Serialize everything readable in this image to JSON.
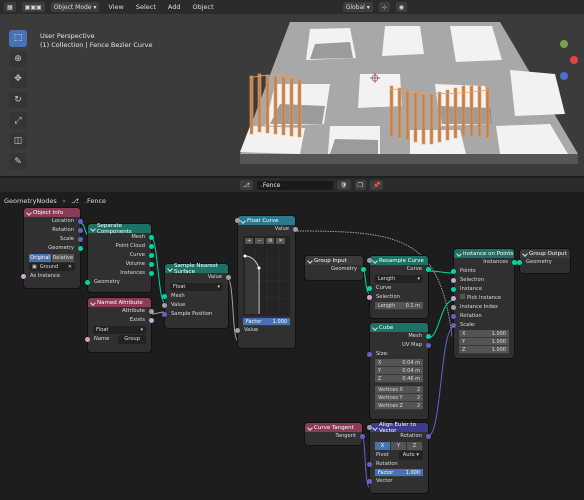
{
  "viewport": {
    "mode": "Object Mode",
    "menus": [
      "View",
      "Select",
      "Add",
      "Object"
    ],
    "transform_orientation": "Global",
    "info_line1": "User Perspective",
    "info_line2": "(1) Collection | Fence Bezier Curve"
  },
  "node_editor": {
    "tree_name": ".Fence",
    "breadcrumb_root": "GeometryNodes",
    "breadcrumb_tree": ".Fence"
  },
  "nodes": {
    "object_info": {
      "title": "Object Info",
      "outputs": [
        "Location",
        "Rotation",
        "Scale",
        "Geometry"
      ],
      "toggle": [
        "Original",
        "Relative"
      ],
      "object_value": "Ground",
      "as_instance": "As Instance"
    },
    "separate_components": {
      "title": "Separate Components",
      "outputs": [
        "Mesh",
        "Point Cloud",
        "Curve",
        "Volume",
        "Instances"
      ],
      "input": "Geometry"
    },
    "named_attribute": {
      "title": "Named Attribute",
      "outputs": [
        "Attribute",
        "Exists"
      ],
      "type": "Float",
      "name_label": "Name",
      "name_value": "Group"
    },
    "sample_nearest_surface": {
      "title": "Sample Nearest Surface",
      "output": "Value",
      "type": "Float",
      "inputs": [
        "Mesh",
        "Value",
        "Sample Position"
      ]
    },
    "float_curve": {
      "title": "Float Curve",
      "output": "Value",
      "factor_label": "Factor",
      "factor_value": "1.000",
      "input": "Value"
    },
    "group_input": {
      "title": "Group Input",
      "output": "Geometry"
    },
    "resample_curve": {
      "title": "Resample Curve",
      "output": "Curve",
      "mode": "Length",
      "inputs": [
        "Curve",
        "Selection"
      ],
      "length_label": "Length",
      "length_value": "0.1 m"
    },
    "cube": {
      "title": "Cube",
      "outputs": [
        "Mesh",
        "UV Map"
      ],
      "size_label": "Size:",
      "size": [
        [
          "X",
          "0.04 m"
        ],
        [
          "Y",
          "0.04 m"
        ],
        [
          "Z",
          "0.46 m"
        ]
      ],
      "vertices": [
        [
          "Vertices X",
          "2"
        ],
        [
          "Vertices Y",
          "2"
        ],
        [
          "Vertices Z",
          "2"
        ]
      ]
    },
    "instance_on_points": {
      "title": "Instance on Points",
      "output": "Instances",
      "inputs": [
        "Points",
        "Selection",
        "Instance",
        "Pick Instance",
        "Instance Index",
        "Rotation"
      ],
      "scale_label": "Scale:",
      "scale": [
        [
          "X",
          "1.000"
        ],
        [
          "Y",
          "1.000"
        ],
        [
          "Z",
          "1.000"
        ]
      ]
    },
    "group_output": {
      "title": "Group Output",
      "input": "Geometry"
    },
    "curve_tangent": {
      "title": "Curve Tangent",
      "output": "Tangent"
    },
    "align_euler": {
      "title": "Align Euler to Vector",
      "output": "Rotation",
      "axes": [
        "X",
        "Y",
        "Z"
      ],
      "active_axis": "X",
      "pivot_label": "Pivot",
      "pivot_value": "Auto",
      "rotation_label": "Rotation",
      "factor_label": "Factor",
      "factor_value": "1.000",
      "vector_label": "Vector"
    }
  },
  "colors": {
    "input_node": "#8a3b56",
    "geometry_node": "#1d7266",
    "vector_node": "#3c3c8a",
    "utility_node": "#2a7a8f",
    "accent": "#4772b3"
  }
}
